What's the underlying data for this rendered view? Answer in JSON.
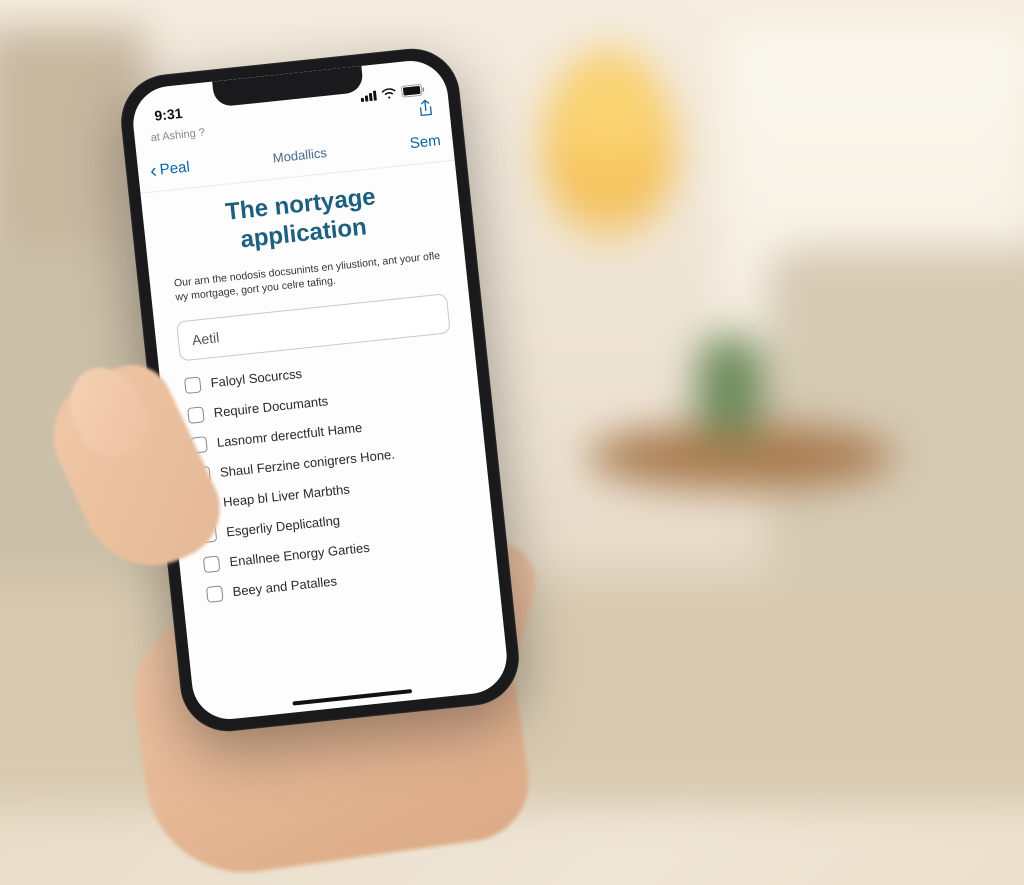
{
  "status": {
    "time": "9:31"
  },
  "nav": {
    "back_label": "Peal",
    "secondary_left": "at Ashing ?",
    "title": "Modallics",
    "action": "Sem"
  },
  "page": {
    "title": "The nortyage application",
    "description": "Our arn the nodosis docsunints en yliustiont, ant your ofle wy mortgage, gort you celre tafing."
  },
  "field": {
    "label": "Aetil"
  },
  "checklist": [
    {
      "label": "Faloyl Socurcss"
    },
    {
      "label": "Require Documants"
    },
    {
      "label": "Lasnomr derectfult Hame"
    },
    {
      "label": "Shaul Ferzine conigrers Hone."
    },
    {
      "label": "Heap bl Liver Marbths"
    },
    {
      "label": "Esgerliy Deplicatlng"
    },
    {
      "label": "Enallnee Enorgy Garties"
    },
    {
      "label": "Beey and Patalles"
    }
  ]
}
